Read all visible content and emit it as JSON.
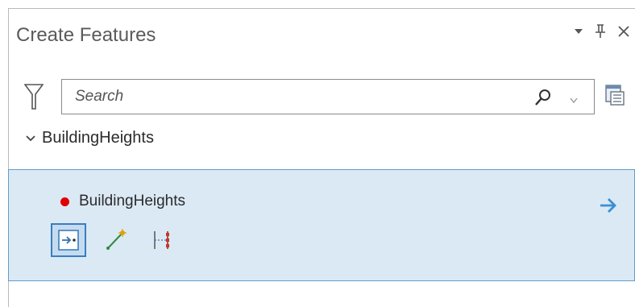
{
  "pane": {
    "title": "Create Features",
    "controls": {
      "options": "▾",
      "pin": "📌",
      "close": "✕"
    }
  },
  "search": {
    "placeholder": "Search",
    "value": ""
  },
  "group": {
    "name": "BuildingHeights",
    "expanded": true
  },
  "template": {
    "name": "BuildingHeights",
    "symbol_color": "#e00000",
    "tools": [
      {
        "name": "point-tool",
        "active": true
      },
      {
        "name": "point-at-end-of-line-tool",
        "active": false
      },
      {
        "name": "points-along-line-tool",
        "active": false
      }
    ]
  },
  "colors": {
    "accent": "#3a7dc0",
    "panel_bg": "#dbe9f5",
    "arrow": "#3a8fd6"
  },
  "icons": {
    "filter": "filter-icon",
    "search": "search-icon",
    "view_options": "view-options-icon",
    "chevron": "chevron-down-icon",
    "arrow": "arrow-right-icon"
  }
}
